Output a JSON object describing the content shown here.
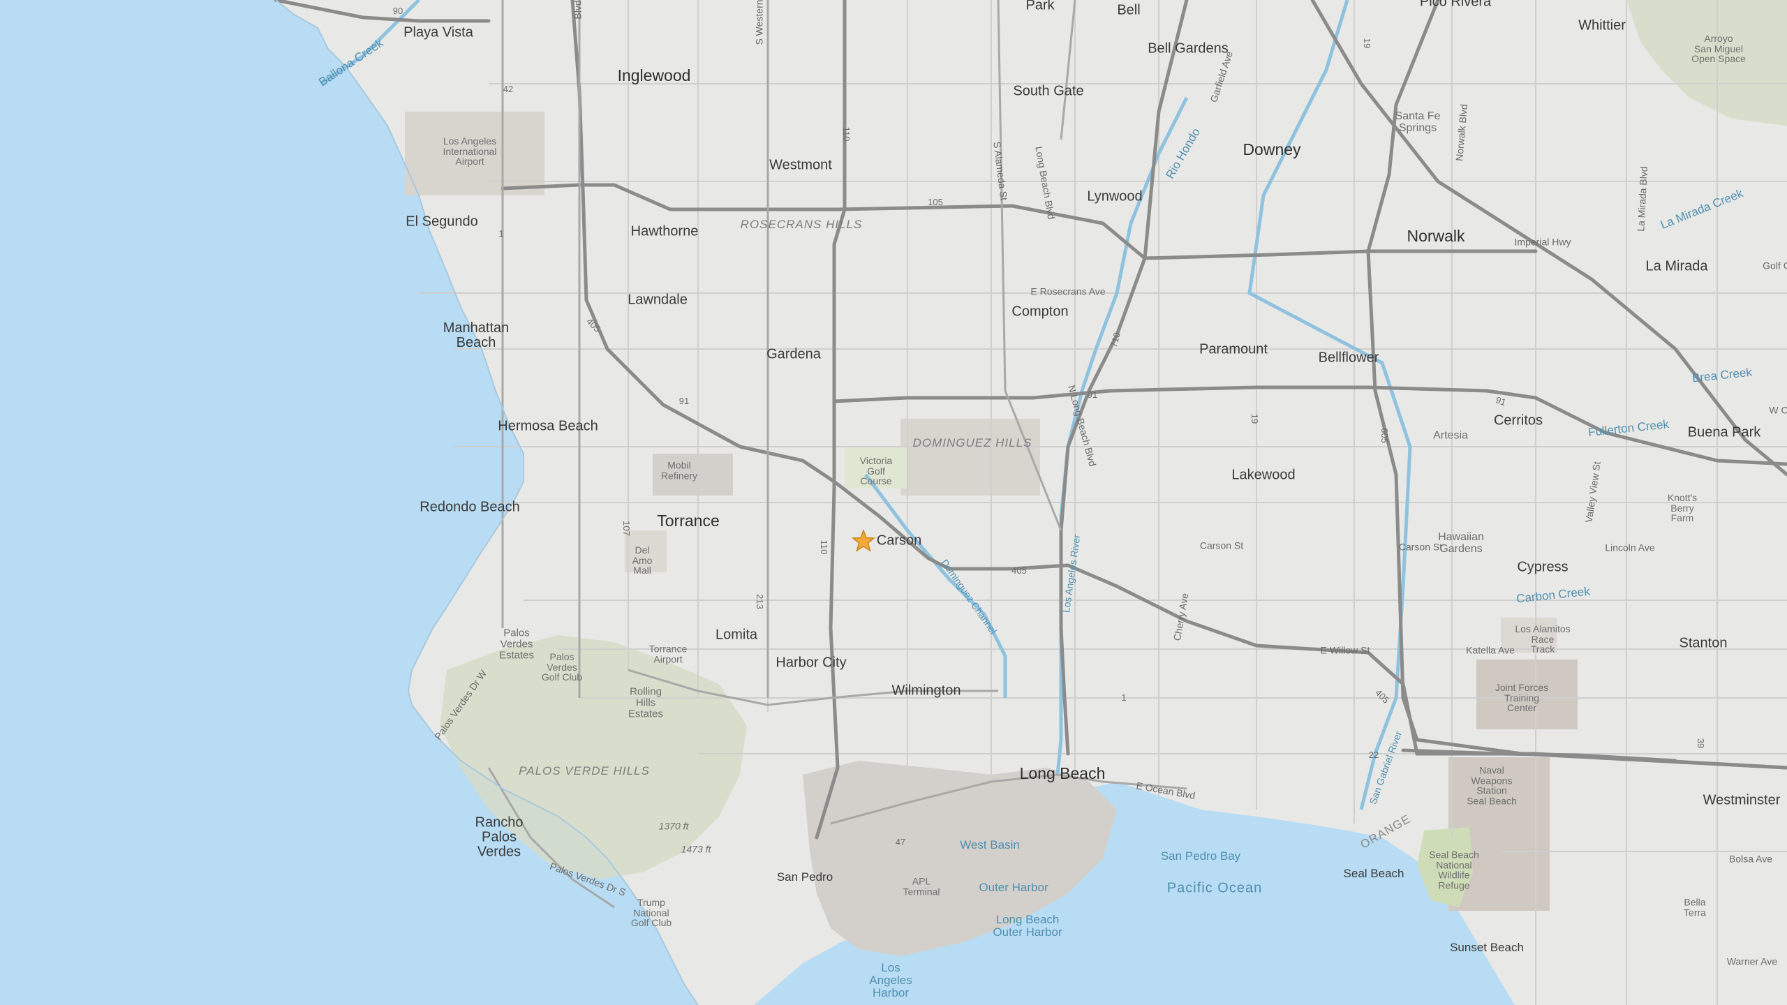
{
  "map": {
    "marker_label": "Carson",
    "colors": {
      "ocean": "#b8dcf3",
      "land": "#e8e8e6",
      "hills": "#d6dcc7",
      "freeway": "#8b8b8b",
      "street": "#c9c9c9",
      "park": "#cfdcb8",
      "industrial": "#d3d0cb",
      "marker": "#f2a93b",
      "river": "#8fc2df"
    },
    "labels": {
      "playa_vista": "Playa Vista",
      "inglewood": "Inglewood",
      "lax": "Los Angeles\nInternational\nAirport",
      "westmont": "Westmont",
      "el_segundo": "El Segundo",
      "hawthorne": "Hawthorne",
      "rosecrans_hills": "ROSECRANS HILLS",
      "lawndale": "Lawndale",
      "manhattan_beach": "Manhattan\nBeach",
      "gardena": "Gardena",
      "hermosa_beach": "Hermosa Beach",
      "mobil_refinery": "Mobil\nRefinery",
      "redondo_beach": "Redondo Beach",
      "torrance": "Torrance",
      "victoria_golf": "Victoria\nGolf\nCourse",
      "del_amo_mall": "Del\nAmo\nMall",
      "palos_verdes_estates": "Palos\nVerdes\nEstates",
      "pv_golf": "Palos\nVerdes\nGolf Club",
      "lomita": "Lomita",
      "torrance_airport": "Torrance\nAirport",
      "harbor_city": "Harbor City",
      "wilmington": "Wilmington",
      "rolling_hills": "Rolling\nHills\nEstates",
      "palos_verde_hills": "PALOS VERDE HILLS",
      "rancho_pv": "Rancho\nPalos\nVerdes",
      "elev_1370": "1370 ft",
      "elev_1473": "1473 ft",
      "san_pedro": "San Pedro",
      "trump_golf": "Trump\nNational\nGolf Club",
      "apl_terminal": "APL\nTerminal",
      "west_basin": "West Basin",
      "outer_harbor": "Outer Harbor",
      "lb_outer_harbor": "Long Beach\nOuter Harbor",
      "la_harbor": "Los\nAngeles\nHarbor",
      "long_beach": "Long Beach",
      "san_pedro_bay": "San Pedro Bay",
      "pacific_ocean": "Pacific Ocean",
      "park": "Park",
      "bell": "Bell",
      "bell_gardens": "Bell Gardens",
      "pico_rivera": "Pico Rivera",
      "whittier": "Whittier",
      "arroyo": "Arroyo\nSan Miguel\nOpen Space",
      "south_gate": "South Gate",
      "santa_fe_springs": "Santa Fe\nSprings",
      "downey": "Downey",
      "lynwood": "Lynwood",
      "norwalk": "Norwalk",
      "imperial_hwy": "Imperial Hwy",
      "la_mirada": "La Mirada",
      "compton": "Compton",
      "e_rosecrans": "E Rosecrans Ave",
      "paramount": "Paramount",
      "bellflower": "Bellflower",
      "dominguez_hills": "DOMINGUEZ HILLS",
      "lakewood": "Lakewood",
      "artesia": "Artesia",
      "cerritos": "Cerritos",
      "buena_park": "Buena Park",
      "knotts": "Knott's\nBerry\nFarm",
      "carson_st": "Carson St",
      "carson_st2": "Carson St",
      "hawaiian_gardens": "Hawaiian\nGardens",
      "lincoln_ave": "Lincoln Ave",
      "cypress": "Cypress",
      "carbon_creek": "Carbon Creek",
      "brea_creek": "Brea Creek",
      "fullerton_creek": "Fullerton Creek",
      "la_mirada_creek": "La Mirada Creek",
      "ballona_creek": "Ballona Creek",
      "rio_hondo": "Rio Hondo",
      "los_alamitos": "Los Alamitos\nRace\nTrack",
      "e_willow": "E Willow St",
      "katella": "Katella Ave",
      "stanton": "Stanton",
      "joint_forces": "Joint Forces\nTraining\nCenter",
      "naval": "Naval\nWeapons\nStation\nSeal Beach",
      "seal_beach_nwr": "Seal Beach\nNational\nWildlife\nRefuge",
      "seal_beach": "Seal Beach",
      "sunset_beach": "Sunset Beach",
      "westminster": "Westminster",
      "bolsa_ave": "Bolsa Ave",
      "warner_ave": "Warner Ave",
      "bella_terra": "Bella\nTerra",
      "orange": "ORANGE",
      "e_ocean_blvd": "E Ocean Blvd",
      "la_river": "Los Angeles River",
      "dominguez_channel": "Dominguez Channel",
      "san_gabriel_river": "San Gabriel River",
      "n_long_beach_blvd": "N Long Beach Blvd",
      "long_beach_blvd": "Long Beach Blvd",
      "s_alameda": "S Alameda St",
      "garfield": "Garfield Ave",
      "cherry_ave": "Cherry Ave",
      "norwalk_blvd": "Norwalk Blvd",
      "la_mirada_blvd": "La Mirada Blvd",
      "valley_view": "Valley View St",
      "s_western": "S Western",
      "pv_dr_w": "Palos Verdes Dr W",
      "pv_dr_s": "Palos Verdes Dr S",
      "golf_c": "Golf C",
      "w_c": "W C",
      "blvd": "Blvd",
      "shield_90": "90",
      "shield_42": "42",
      "shield_105": "105",
      "shield_110a": "110",
      "shield_110b": "110",
      "shield_405a": "405",
      "shield_405b": "405",
      "shield_405c": "405",
      "shield_91a": "91",
      "shield_91b": "91",
      "shield_91c": "91",
      "shield_107": "107",
      "shield_213": "213",
      "shield_710": "710",
      "shield_605": "605",
      "shield_19a": "19",
      "shield_19b": "19",
      "shield_1a": "1",
      "shield_1b": "1",
      "shield_47": "47",
      "shield_22": "22",
      "shield_39": "39"
    }
  }
}
